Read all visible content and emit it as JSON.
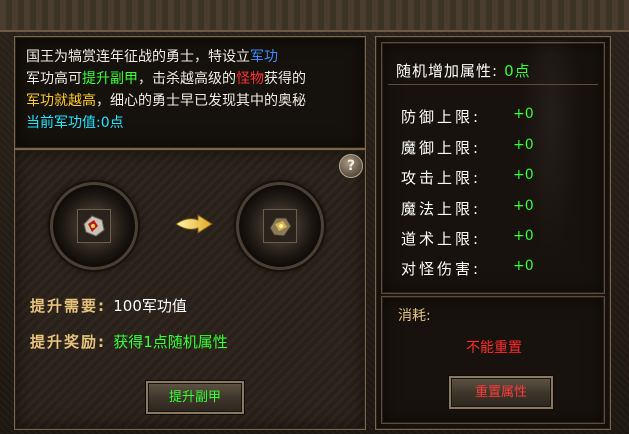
{
  "intro": {
    "line1": [
      {
        "text": "国王为犒赏连年征战的勇士，特设立",
        "color": "white"
      },
      {
        "text": "军功",
        "color": "blue"
      }
    ],
    "line2": [
      {
        "text": "军功高可",
        "color": "white"
      },
      {
        "text": "提升副甲",
        "color": "green"
      },
      {
        "text": "，击杀越高级的",
        "color": "white"
      },
      {
        "text": "怪物",
        "color": "red"
      },
      {
        "text": "获得的",
        "color": "white"
      }
    ],
    "line3": [
      {
        "text": "军功就越高",
        "color": "gold"
      },
      {
        "text": "，细心的勇士早已发现其中的奥秘",
        "color": "white"
      }
    ],
    "current_merit_label": "当前军功值:",
    "current_merit_value": "0点"
  },
  "help": {
    "label": "?"
  },
  "upgrade": {
    "need_label": "提升需要:",
    "need_value": "100军功值",
    "reward_label": "提升奖励:",
    "reward_value": "获得1点随机属性",
    "button_label": "提升副甲"
  },
  "attributes": {
    "title_label": "随机增加属性:",
    "title_value": "0点",
    "rows": [
      {
        "label": "防御上限:",
        "value": "+0"
      },
      {
        "label": "魔御上限:",
        "value": "+0"
      },
      {
        "label": "攻击上限:",
        "value": "+0"
      },
      {
        "label": "魔法上限:",
        "value": "+0"
      },
      {
        "label": "道术上限:",
        "value": "+0"
      },
      {
        "label": "对怪伤害:",
        "value": "+0"
      }
    ]
  },
  "consume": {
    "label": "消耗:",
    "status": "不能重置",
    "button_label": "重置属性"
  },
  "colors": {
    "white": "#f0ebe0",
    "blue": "#3d8cff",
    "green": "#33ff33",
    "red": "#ff3030",
    "gold": "#ffcc22",
    "cyan": "#19e6ff"
  }
}
